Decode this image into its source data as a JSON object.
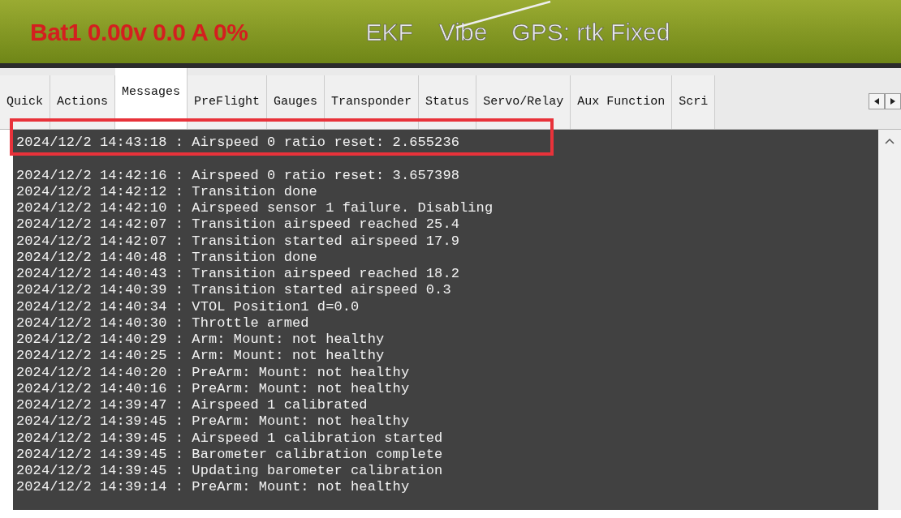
{
  "status_bar": {
    "battery": "Bat1 0.00v 0.0 A 0%",
    "ekf": "EKF",
    "vibe": "Vibe",
    "gps": "GPS: rtk Fixed"
  },
  "tabs": [
    {
      "label": "Quick",
      "selected": false
    },
    {
      "label": "Actions",
      "selected": false
    },
    {
      "label": "Messages",
      "selected": true
    },
    {
      "label": "PreFlight",
      "selected": false
    },
    {
      "label": "Gauges",
      "selected": false
    },
    {
      "label": "Transponder",
      "selected": false
    },
    {
      "label": "Status",
      "selected": false
    },
    {
      "label": "Servo/Relay",
      "selected": false
    },
    {
      "label": "Aux Function",
      "selected": false
    },
    {
      "label": "Scri",
      "selected": false
    }
  ],
  "messages": [
    {
      "kind": "line",
      "text": "2024/12/2 14:43:18 : Airspeed 0 ratio reset: 2.655236"
    },
    {
      "kind": "obscured"
    },
    {
      "kind": "line",
      "text": "2024/12/2 14:42:16 : Airspeed 0 ratio reset: 3.657398"
    },
    {
      "kind": "line",
      "text": "2024/12/2 14:42:12 : Transition done"
    },
    {
      "kind": "line",
      "text": "2024/12/2 14:42:10 : Airspeed sensor 1 failure. Disabling"
    },
    {
      "kind": "line",
      "text": "2024/12/2 14:42:07 : Transition airspeed reached 25.4"
    },
    {
      "kind": "line",
      "text": "2024/12/2 14:42:07 : Transition started airspeed 17.9"
    },
    {
      "kind": "line",
      "text": "2024/12/2 14:40:48 : Transition done"
    },
    {
      "kind": "line",
      "text": "2024/12/2 14:40:43 : Transition airspeed reached 18.2"
    },
    {
      "kind": "line",
      "text": "2024/12/2 14:40:39 : Transition started airspeed 0.3"
    },
    {
      "kind": "line",
      "text": "2024/12/2 14:40:34 : VTOL Position1 d=0.0"
    },
    {
      "kind": "line",
      "text": "2024/12/2 14:40:30 : Throttle armed"
    },
    {
      "kind": "line",
      "text": "2024/12/2 14:40:29 : Arm: Mount: not healthy"
    },
    {
      "kind": "line",
      "text": "2024/12/2 14:40:25 : Arm: Mount: not healthy"
    },
    {
      "kind": "line",
      "text": "2024/12/2 14:40:20 : PreArm: Mount: not healthy"
    },
    {
      "kind": "line",
      "text": "2024/12/2 14:40:16 : PreArm: Mount: not healthy"
    },
    {
      "kind": "line",
      "text": "2024/12/2 14:39:47 : Airspeed 1 calibrated"
    },
    {
      "kind": "line",
      "text": "2024/12/2 14:39:45 : PreArm: Mount: not healthy"
    },
    {
      "kind": "line",
      "text": "2024/12/2 14:39:45 : Airspeed 1 calibration started"
    },
    {
      "kind": "line",
      "text": "2024/12/2 14:39:45 : Barometer calibration complete"
    },
    {
      "kind": "line",
      "text": "2024/12/2 14:39:45 : Updating barometer calibration"
    },
    {
      "kind": "line",
      "text": "2024/12/2 14:39:14 : PreArm: Mount: not healthy"
    }
  ]
}
